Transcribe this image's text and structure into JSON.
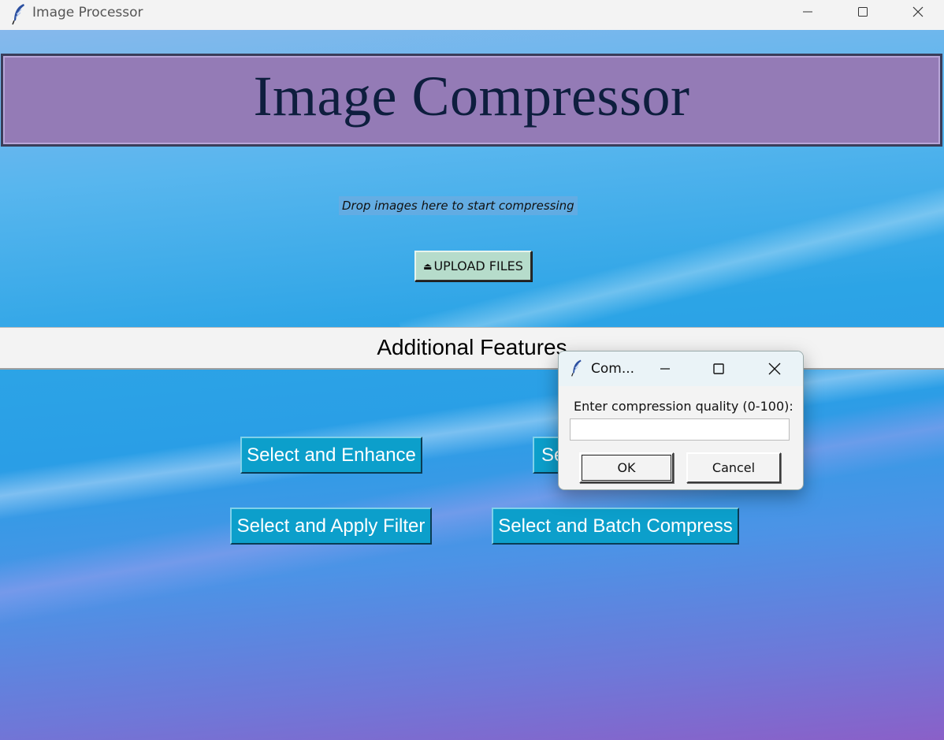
{
  "window": {
    "title": "Image Processor",
    "icon": "feather-icon"
  },
  "header": {
    "title": "Image Compressor"
  },
  "upload": {
    "drop_text": "Drop images here to start compressing",
    "button_label": "UPLOAD FILES",
    "button_icon": "eject-icon"
  },
  "features": {
    "title": "Additional Features",
    "buttons": [
      {
        "label": "Select and Enhance"
      },
      {
        "label": "Se"
      },
      {
        "label": "Select and Apply Filter"
      },
      {
        "label": "Select and Batch Compress"
      }
    ]
  },
  "dialog": {
    "title": "Com...",
    "prompt": "Enter compression quality (0-100):",
    "input_value": "",
    "ok_label": "OK",
    "cancel_label": "Cancel"
  },
  "colors": {
    "header_bg": "#947bb6",
    "header_text": "#0e1e3e",
    "feature_button": "#0c9fcb",
    "upload_button": "#b6dccb"
  }
}
